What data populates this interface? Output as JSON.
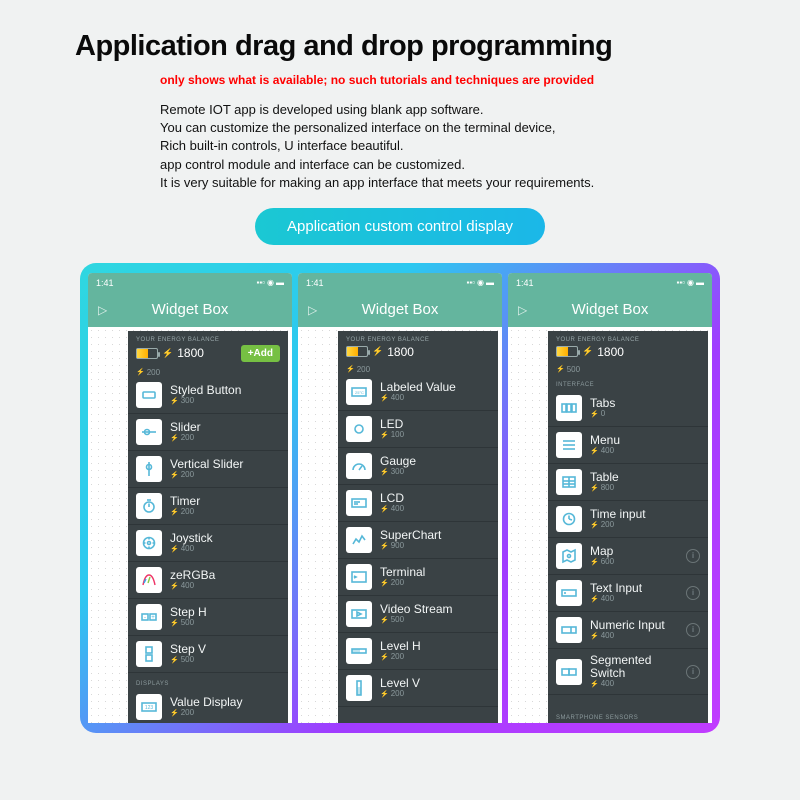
{
  "header": {
    "title": "Application drag and drop programming",
    "subtitle": "only shows what is available; no such tutorials and techniques are provided",
    "description": "Remote IOT app is developed using blank app software.\nYou can customize the personalized interface on the terminal device,\nRich built-in controls, U interface beautiful.\napp control module and interface can be customized.\nIt is very suitable for making an app interface that meets your requirements.",
    "badge": "Application custom control display"
  },
  "phone": {
    "time": "1:41",
    "app_title": "Widget Box",
    "energy_label": "YOUR ENERGY BALANCE",
    "energy_value": "1800",
    "add_label": "+Add"
  },
  "screens": [
    {
      "id": "left",
      "show_add": true,
      "top_partial": {
        "cost": "200"
      },
      "items": [
        {
          "name": "Styled Button",
          "cost": "300",
          "icon": "button"
        },
        {
          "name": "Slider",
          "cost": "200",
          "icon": "slider-h"
        },
        {
          "name": "Vertical Slider",
          "cost": "200",
          "icon": "slider-v"
        },
        {
          "name": "Timer",
          "cost": "200",
          "icon": "timer"
        },
        {
          "name": "Joystick",
          "cost": "400",
          "icon": "joystick"
        },
        {
          "name": "zeRGBa",
          "cost": "400",
          "icon": "zebra"
        },
        {
          "name": "Step H",
          "cost": "500",
          "icon": "step-h"
        },
        {
          "name": "Step V",
          "cost": "500",
          "icon": "step-v"
        }
      ],
      "section": "DISPLAYS",
      "tail": {
        "name": "Value Display",
        "cost": "200",
        "icon": "value"
      }
    },
    {
      "id": "middle",
      "show_add": false,
      "top_partial": {
        "cost": "200"
      },
      "items": [
        {
          "name": "Labeled Value",
          "cost": "400",
          "icon": "labeled"
        },
        {
          "name": "LED",
          "cost": "100",
          "icon": "led"
        },
        {
          "name": "Gauge",
          "cost": "300",
          "icon": "gauge"
        },
        {
          "name": "LCD",
          "cost": "400",
          "icon": "lcd"
        },
        {
          "name": "SuperChart",
          "cost": "900",
          "icon": "chart"
        },
        {
          "name": "Terminal",
          "cost": "200",
          "icon": "terminal"
        },
        {
          "name": "Video Stream",
          "cost": "500",
          "icon": "video"
        },
        {
          "name": "Level H",
          "cost": "200",
          "icon": "level-h"
        },
        {
          "name": "Level V",
          "cost": "200",
          "icon": "level-v"
        }
      ]
    },
    {
      "id": "right",
      "show_add": false,
      "top_partial": {
        "cost": "500"
      },
      "section_top": "INTERFACE",
      "items": [
        {
          "name": "Tabs",
          "cost": "0",
          "icon": "tabs"
        },
        {
          "name": "Menu",
          "cost": "400",
          "icon": "menu"
        },
        {
          "name": "Table",
          "cost": "800",
          "icon": "table"
        },
        {
          "name": "Time input",
          "cost": "200",
          "icon": "time"
        },
        {
          "name": "Map",
          "cost": "600",
          "icon": "map"
        },
        {
          "name": "Text Input",
          "cost": "400",
          "icon": "text"
        },
        {
          "name": "Numeric Input",
          "cost": "400",
          "icon": "numeric"
        },
        {
          "name": "Segmented Switch",
          "cost": "400",
          "icon": "segment"
        }
      ],
      "section": "SMARTPHONE SENSORS"
    }
  ]
}
